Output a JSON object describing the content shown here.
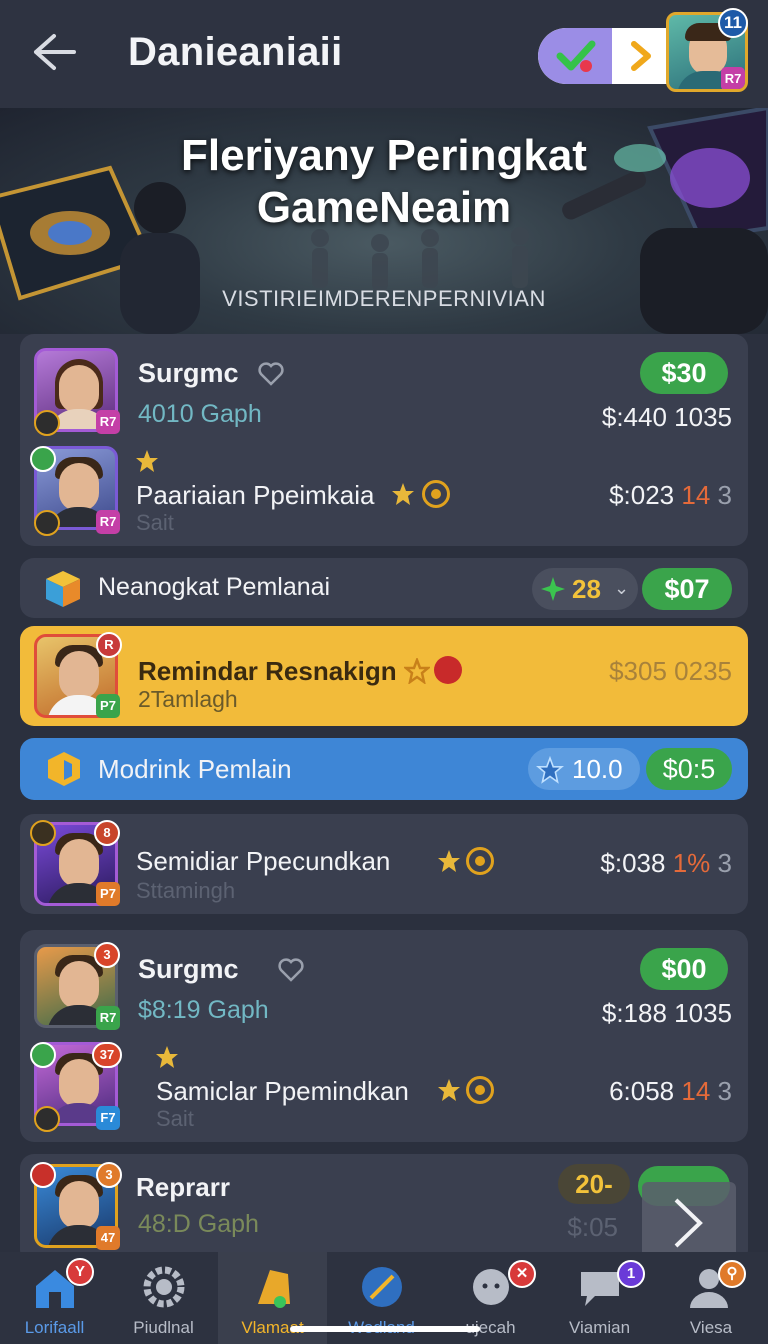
{
  "header": {
    "title": "Danieaniaii",
    "avatar_badge": "11",
    "avatar_level": "R7"
  },
  "hero": {
    "title_line1": "Fleriyany Peringkat",
    "title_line2": "GameNeaim",
    "subtitle": "VISTIRIEIMDERENPERNIVIAN"
  },
  "card1": {
    "name": "Surgmc",
    "subtitle": "4010 Gaph",
    "prize": "$30",
    "value": "$:440 1035",
    "level": "R7",
    "row2_name": "Paariaian Ppeimkaia",
    "row2_sub": "Sait",
    "row2_value_a": "$:023",
    "row2_value_b": "14",
    "row2_value_c": "3",
    "row2_level": "R7"
  },
  "row_neanogkat": {
    "label": "Neanogkat Pemlanai",
    "count": "28",
    "prize": "$07"
  },
  "row_remindar": {
    "name": "Remindar Resnakign",
    "subtitle": "2Tamlagh",
    "value": "$305 0235",
    "badge": "R",
    "level": "P7"
  },
  "row_modrink": {
    "label": "Modrink Pemlain",
    "score": "10.0",
    "prize": "$0:5"
  },
  "card3": {
    "name": "Semidiar Ppecundkan",
    "subtitle": "Sttamingh",
    "value_a": "$:038",
    "value_b": "1%",
    "value_c": "3",
    "badge": "8",
    "level": "P7"
  },
  "card4": {
    "name": "Surgmc",
    "subtitle": "$8:19 Gaph",
    "prize": "$00",
    "value": "$:188 1035",
    "badge": "3",
    "level": "R7",
    "row2_name": "Samiclar Ppemindkan",
    "row2_sub": "Sait",
    "row2_value_a": "6:058",
    "row2_value_b": "14",
    "row2_value_c": "3",
    "row2_badge": "37",
    "row2_level": "F7"
  },
  "card5": {
    "name": "Reprarr",
    "subtitle": "48:D Gaph",
    "count": "20-",
    "value": "$:05",
    "badge": "3",
    "level": "47"
  },
  "nav": {
    "items": [
      {
        "label": "Lorifaall",
        "badge": "Y"
      },
      {
        "label": "Piudlnal"
      },
      {
        "label": "Vlamaat"
      },
      {
        "label": "Wedland"
      },
      {
        "label": "ujecah"
      },
      {
        "label": "Viamian",
        "badge": "1"
      },
      {
        "label": "Viesa"
      }
    ]
  },
  "colors": {
    "background": "#2b303e",
    "card": "#3a3f4f",
    "gold_row": "#f2bb3a",
    "blue_row": "#3e86d6",
    "green_pill": "#3aa44b",
    "accent_orange": "#e46a3a"
  }
}
